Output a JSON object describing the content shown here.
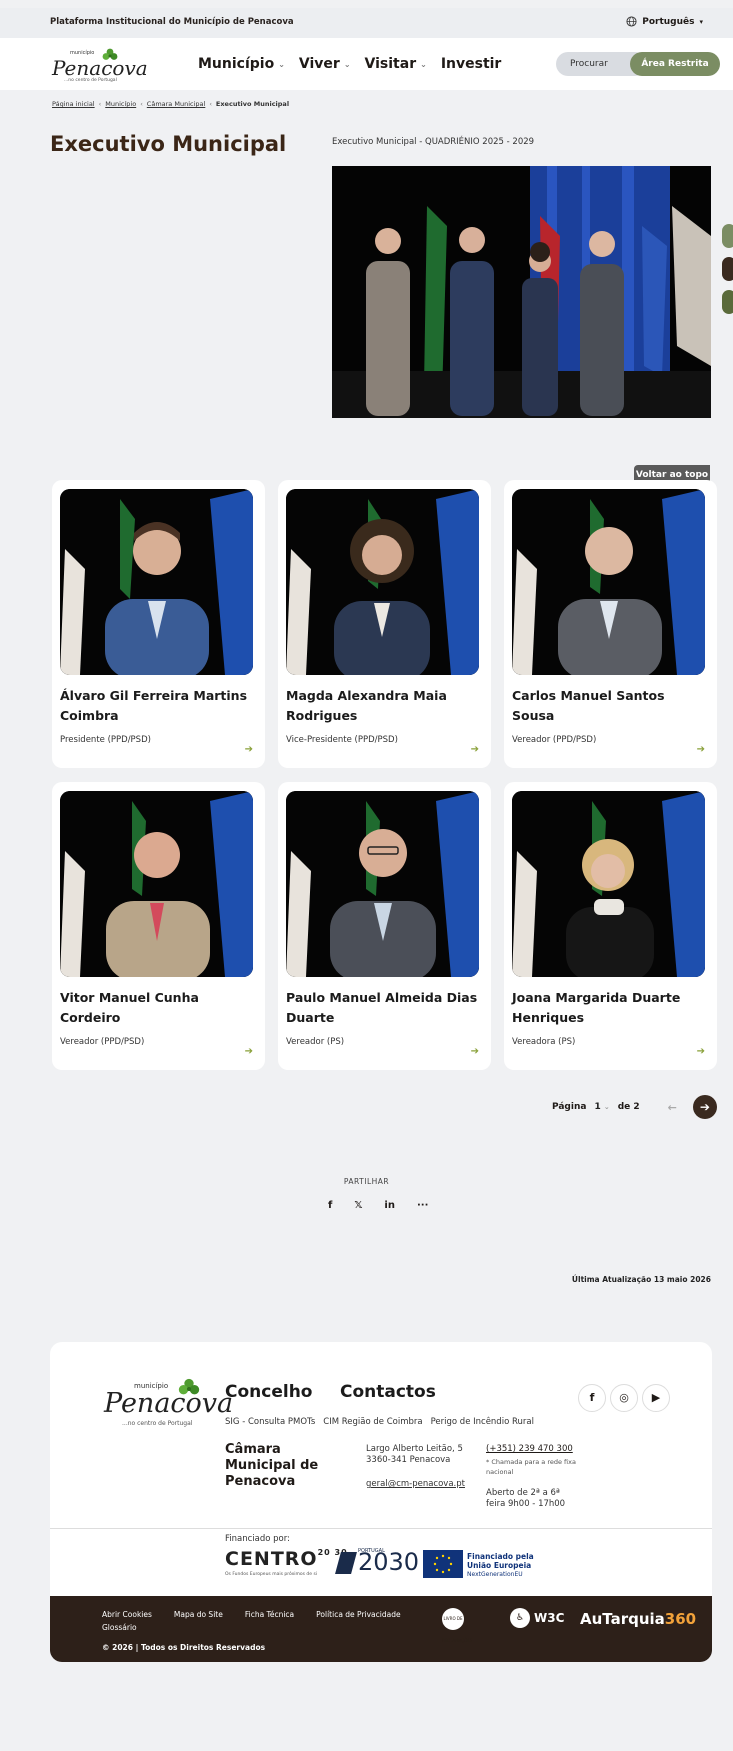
{
  "topbar": {
    "institution": "Plataforma Institucional do Município de Penacova",
    "language": "Português"
  },
  "header": {
    "logo_small": "município",
    "logo_name": "Penacova",
    "logo_tagline": "...no centro de Portugal",
    "nav": [
      {
        "label": "Município",
        "has_menu": true
      },
      {
        "label": "Viver",
        "has_menu": true
      },
      {
        "label": "Visitar",
        "has_menu": true
      },
      {
        "label": "Investir",
        "has_menu": false
      }
    ],
    "search_placeholder": "Procurar",
    "restricted_label": "Área Restrita"
  },
  "breadcrumb": {
    "items": [
      "Página inicial",
      "Município",
      "Câmara Municipal"
    ],
    "current": "Executivo Municipal"
  },
  "page": {
    "title": "Executivo Municipal",
    "subtitle": "Executivo Municipal - QUADRIÉNIO 2025 - 2029"
  },
  "back_to_top": "Voltar ao topo",
  "members": [
    {
      "name": "Álvaro Gil Ferreira Martins Coimbra",
      "role": "Presidente (PPD/PSD)"
    },
    {
      "name": "Magda Alexandra Maia Rodrigues",
      "role": "Vice-Presidente (PPD/PSD)"
    },
    {
      "name": "Carlos Manuel Santos Sousa",
      "role": "Vereador (PPD/PSD)"
    },
    {
      "name": "Vitor Manuel Cunha Cordeiro",
      "role": "Vereador (PPD/PSD)"
    },
    {
      "name": "Paulo Manuel Almeida Dias Duarte",
      "role": "Vereador (PS)"
    },
    {
      "name": "Joana Margarida Duarte Henriques",
      "role": "Vereadora (PS)"
    }
  ],
  "pagination": {
    "label": "Página",
    "current": "1",
    "of": "de 2"
  },
  "share": {
    "label": "PARTILHAR",
    "items": [
      "f",
      "𝕏",
      "in",
      "···"
    ]
  },
  "last_update": "Última Atualização 13 maio 2026",
  "footer": {
    "logo_small": "município",
    "logo_name": "Penacova",
    "logo_tagline": "...no centro de Portugal",
    "concelho_title": "Concelho",
    "contactos_title": "Contactos",
    "links": [
      "SIG - Consulta PMOTs",
      "CIM Região de Coimbra",
      "Perigo de Incêndio Rural"
    ],
    "entity": "Câmara Municipal de Penacova",
    "address": "Largo Alberto Leitão, 5 3360-341 Penacova",
    "email": "geral@cm-penacova.pt",
    "phone": "(+351) 239 470 300",
    "phone_note": "* Chamada para a rede fixa nacional",
    "hours": "Aberto de 2ª a 6ª feira 9h00 - 17h00",
    "social": [
      "f",
      "◎",
      "▶"
    ],
    "funded_by": "Financiado por:",
    "centro": "CENTRO",
    "centro_years": "20 30",
    "centro_sub": "Os Fundos Europeus mais próximos de si",
    "portugal2030_small": "PORTUGAL",
    "portugal2030": "2030",
    "eu_line1": "Financiado pela",
    "eu_line2": "União Europeia",
    "eu_line3": "NextGenerationEU",
    "bottom_links": [
      "Abrir Cookies",
      "Mapa do Site",
      "Ficha Técnica",
      "Política de Privacidade"
    ],
    "glossary": "Glossário",
    "copyright": "© 2026 | Todos os Direitos Reservados",
    "reclamacoes": "LIVRO DE RECLAMAÇÕES",
    "w3c": "W3C",
    "autarquia": "AuTarquia",
    "autarquia_num": "360"
  },
  "colors": {
    "title_brown": "#3b2617",
    "accent_green": "#7b8d63",
    "footer_dark": "#2d2019"
  }
}
